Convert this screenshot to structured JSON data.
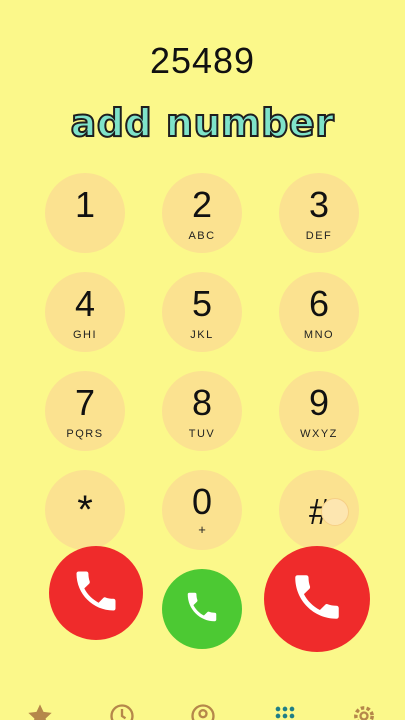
{
  "dialer": {
    "number": "25489",
    "caption": "add number",
    "keys": [
      {
        "digit": "1",
        "letters": ""
      },
      {
        "digit": "2",
        "letters": "ABC"
      },
      {
        "digit": "3",
        "letters": "DEF"
      },
      {
        "digit": "4",
        "letters": "GHI"
      },
      {
        "digit": "5",
        "letters": "JKL"
      },
      {
        "digit": "6",
        "letters": "MNO"
      },
      {
        "digit": "7",
        "letters": "PQRS"
      },
      {
        "digit": "8",
        "letters": "TUV"
      },
      {
        "digit": "9",
        "letters": "WXYZ"
      },
      {
        "digit": "*",
        "letters": ""
      },
      {
        "digit": "0",
        "letters": "+"
      },
      {
        "digit": "#",
        "letters": ""
      }
    ]
  },
  "call_buttons": [
    {
      "icon": "phone-icon",
      "color": "#ef2b2b"
    },
    {
      "icon": "phone-icon",
      "color": "#4cc933"
    },
    {
      "icon": "phone-icon",
      "color": "#ef2b2b"
    }
  ],
  "bottom_nav": [
    {
      "icon": "star-icon"
    },
    {
      "icon": "recents-clock-icon"
    },
    {
      "icon": "contact-icon"
    },
    {
      "icon": "dialpad-icon"
    },
    {
      "icon": "settings-gear-icon"
    }
  ],
  "colors": {
    "background": "#fbf88a",
    "key_background": "#fbe290",
    "caption_fill": "#7fe3c9"
  }
}
